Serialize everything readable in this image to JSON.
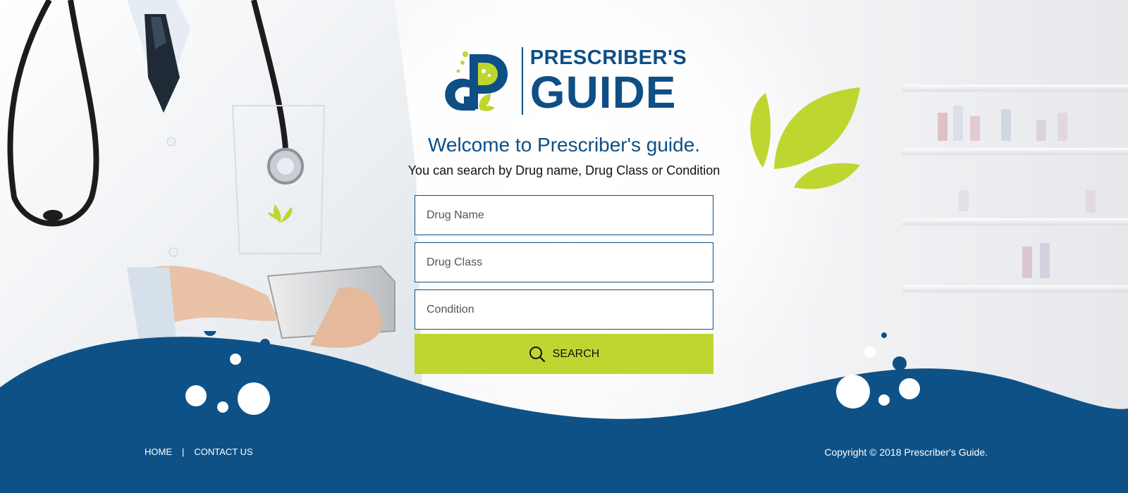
{
  "brand": {
    "name_top": "PRESCRIBER'S",
    "name_bottom": "GUIDE",
    "monogram": "PG"
  },
  "hero": {
    "welcome": "Welcome to Prescriber's guide.",
    "subtitle": "You can search by Drug name, Drug Class or Condition"
  },
  "search_form": {
    "drug_name": {
      "placeholder": "Drug Name",
      "value": ""
    },
    "drug_class": {
      "placeholder": "Drug Class",
      "value": ""
    },
    "condition": {
      "placeholder": "Condition",
      "value": ""
    },
    "button_label": "SEARCH",
    "button_icon": "search-icon"
  },
  "footer": {
    "links": [
      {
        "label": "HOME"
      },
      {
        "label": "CONTACT US"
      }
    ],
    "separator": "|",
    "copyright": "Copyright © 2018 Prescriber's Guide."
  },
  "colors": {
    "brand_blue": "#0e4f86",
    "accent_green": "#bfd630",
    "footer_wave": "#0e5186"
  }
}
